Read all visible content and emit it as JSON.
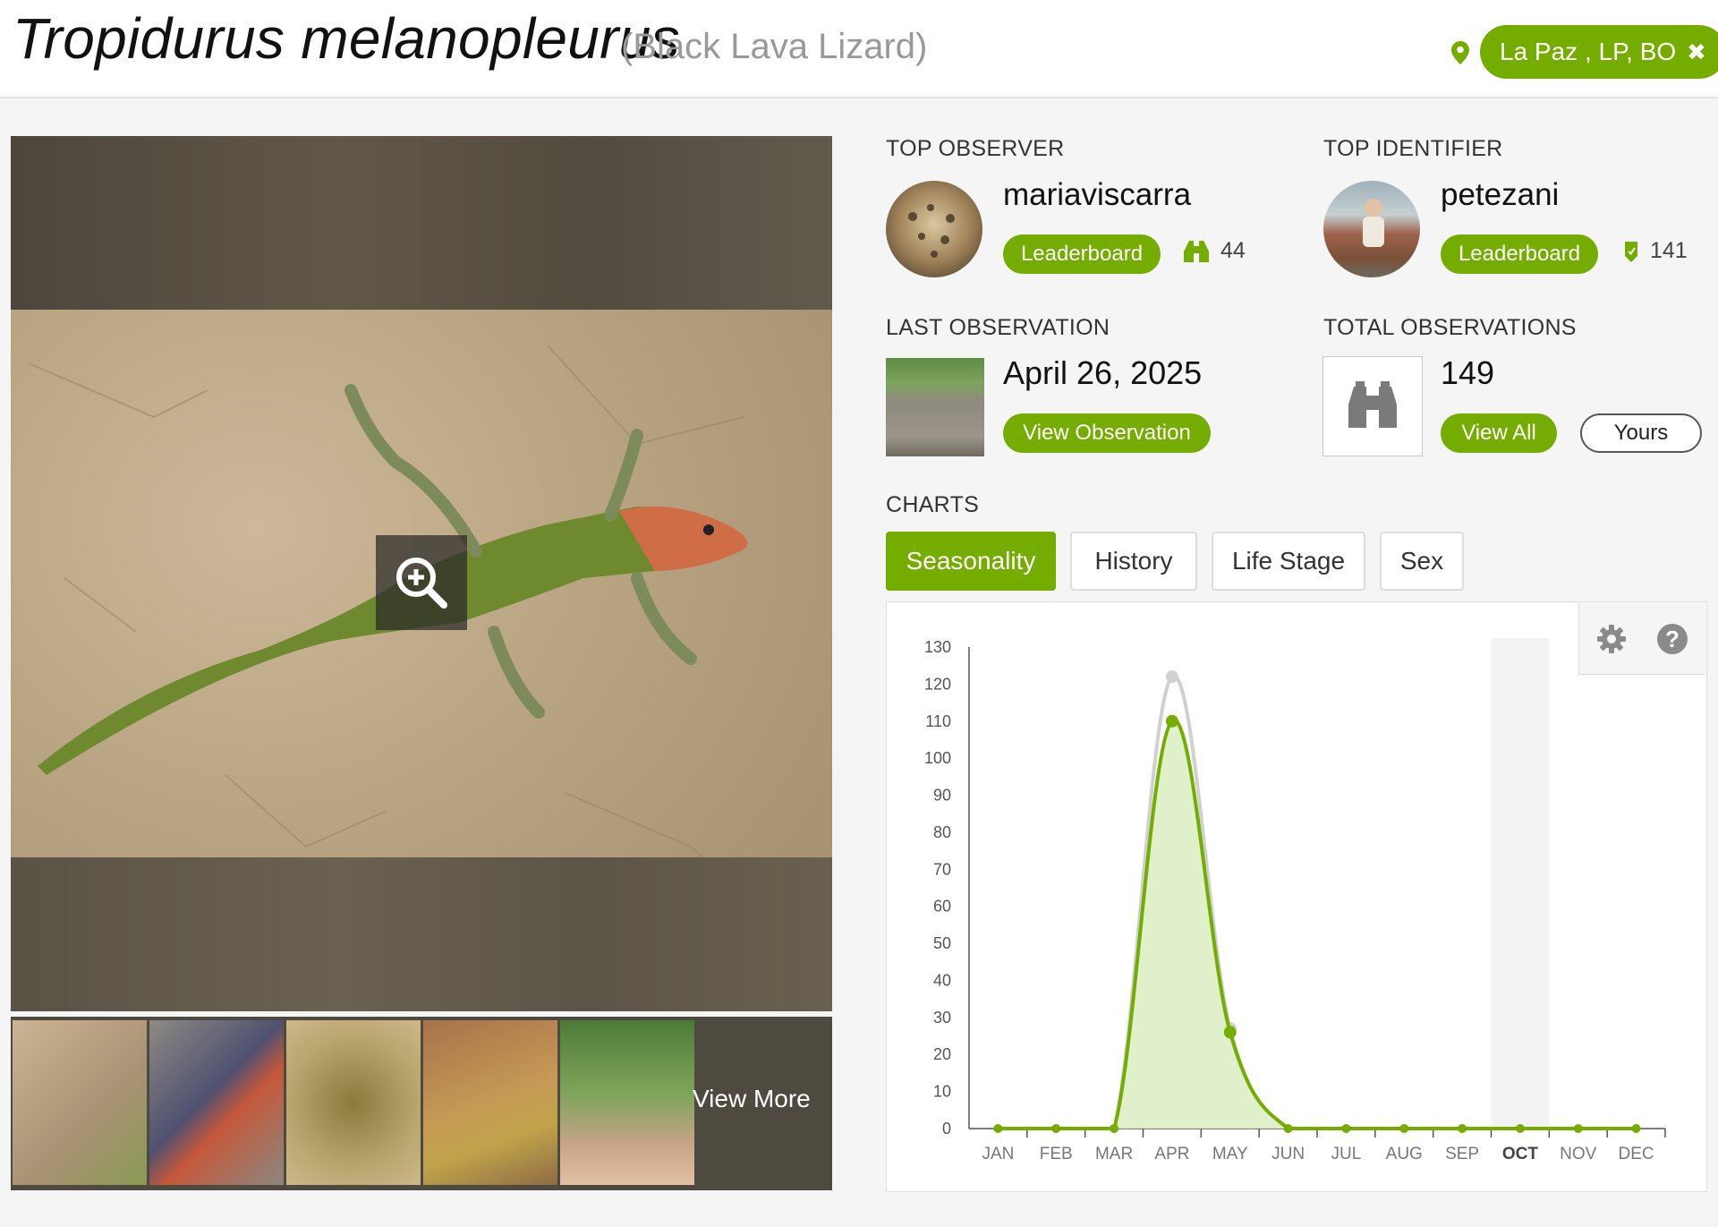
{
  "header": {
    "scientific_name": "Tropidurus melanopleurus",
    "common_name": "(Black Lava Lizard)",
    "place_filter": "La Paz , LP, BO",
    "place_clear_icon": "close-icon",
    "place_pin_icon": "map-pin-icon"
  },
  "photos": {
    "zoom_icon": "zoom-in-icon",
    "view_more_label": "View More"
  },
  "top_observer": {
    "label": "TOP OBSERVER",
    "username": "mariaviscarra",
    "leaderboard_label": "Leaderboard",
    "count": "44",
    "count_icon": "binoculars-icon"
  },
  "top_identifier": {
    "label": "TOP IDENTIFIER",
    "username": "petezani",
    "leaderboard_label": "Leaderboard",
    "count": "141",
    "count_icon": "id-tag-icon"
  },
  "last_observation": {
    "label": "LAST OBSERVATION",
    "date": "April 26, 2025",
    "button_label": "View Observation"
  },
  "total_observations": {
    "label": "TOTAL OBSERVATIONS",
    "count": "149",
    "view_all_label": "View All",
    "yours_label": "Yours"
  },
  "charts": {
    "label": "CHARTS",
    "tabs": [
      {
        "label": "Seasonality",
        "active": true
      },
      {
        "label": "History",
        "active": false
      },
      {
        "label": "Life Stage",
        "active": false
      },
      {
        "label": "Sex",
        "active": false
      }
    ],
    "tool_icons": [
      "gear-icon",
      "help-icon"
    ]
  },
  "colors": {
    "brand_green": "#74ac00",
    "series_fill": "#ddeec5",
    "gray_series": "#d0d0d0",
    "current_month_band": "#f3f3f3"
  },
  "chart_data": {
    "type": "area",
    "categories": [
      "JAN",
      "FEB",
      "MAR",
      "APR",
      "MAY",
      "JUN",
      "JUL",
      "AUG",
      "SEP",
      "OCT",
      "NOV",
      "DEC"
    ],
    "series": [
      {
        "values": [
          0,
          0,
          0,
          110,
          26,
          0,
          0,
          0,
          0,
          0,
          0,
          0
        ]
      },
      {
        "values": [
          0,
          0,
          0,
          122,
          27,
          0,
          0,
          0,
          0,
          0,
          0,
          0
        ]
      }
    ],
    "yticks": [
      0,
      10,
      20,
      30,
      40,
      50,
      60,
      70,
      80,
      90,
      100,
      110,
      120,
      130
    ],
    "ylim": [
      0,
      130
    ],
    "highlighted_category": "OCT",
    "grid": false
  }
}
